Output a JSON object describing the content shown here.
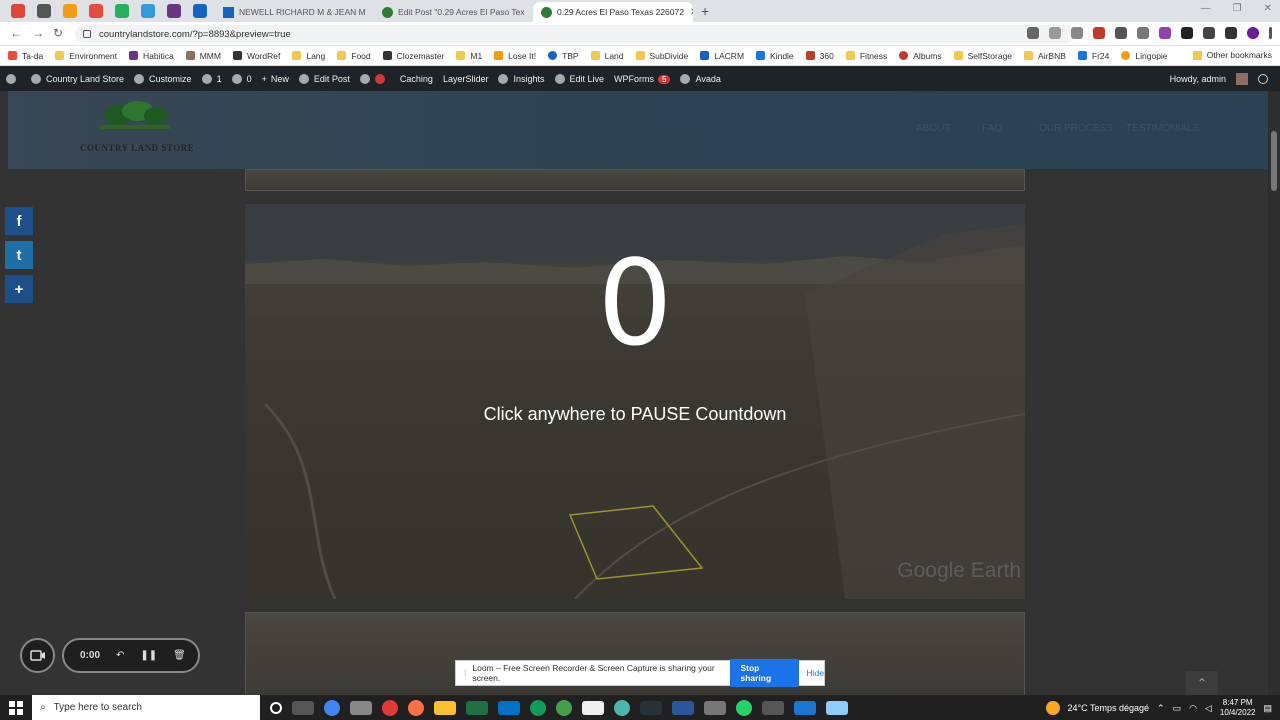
{
  "tabs": [
    {
      "label": "NEWELL RICHARD M & JEAN M"
    },
    {
      "label": "Edit Post \"0.29 Acres El Paso Tex"
    },
    {
      "label": "0.29 Acres El Paso Texas 226072"
    }
  ],
  "address": {
    "url": "countrylandstore.com/?p=8893&preview=true"
  },
  "bookmarks": [
    "Ta-da",
    "Environment",
    "Habitica",
    "MMM",
    "WordRef",
    "Lang",
    "Food",
    "Clozemaster",
    "M1",
    "Lose It!",
    "TBP",
    "Land",
    "SubDivide",
    "LACRM",
    "Kindle",
    "360",
    "Fitness",
    "Albums",
    "SelfStorage",
    "AirBNB",
    "Fr24",
    "Lingopie"
  ],
  "bookmarks_other": "Other bookmarks",
  "wpbar": {
    "site": "Country Land Store",
    "customize": "Customize",
    "updates": "1",
    "comments": "0",
    "new": "New",
    "edit": "Edit Post",
    "caching": "Caching",
    "layerslider": "LayerSlider",
    "insights": "Insights",
    "editlive": "Edit Live",
    "wpforms": "WPForms",
    "wpforms_count": "5",
    "avada": "Avada",
    "howdy": "Howdy, admin"
  },
  "site": {
    "logo_text": "COUNTRY LAND STORE",
    "nav": [
      "ABOUT",
      "FAQ",
      "OUR PROCESS",
      "TESTIMONIALS"
    ]
  },
  "hero": {
    "countdown": "0",
    "message": "Click anywhere to PAUSE Countdown",
    "watermark": "Google Earth"
  },
  "loom": {
    "timer": "0:00",
    "banner": "Loom – Free Screen Recorder & Screen Capture is sharing your screen.",
    "stop": "Stop sharing",
    "hide": "Hide"
  },
  "taskbar": {
    "search": "Type here to search",
    "weather": "24°C  Temps dégagé",
    "time": "8:47 PM",
    "date": "10/4/2022"
  },
  "colors": {
    "wpbar": "#1d2327",
    "accent": "#1a73e8",
    "share": "#1e4f8a"
  }
}
